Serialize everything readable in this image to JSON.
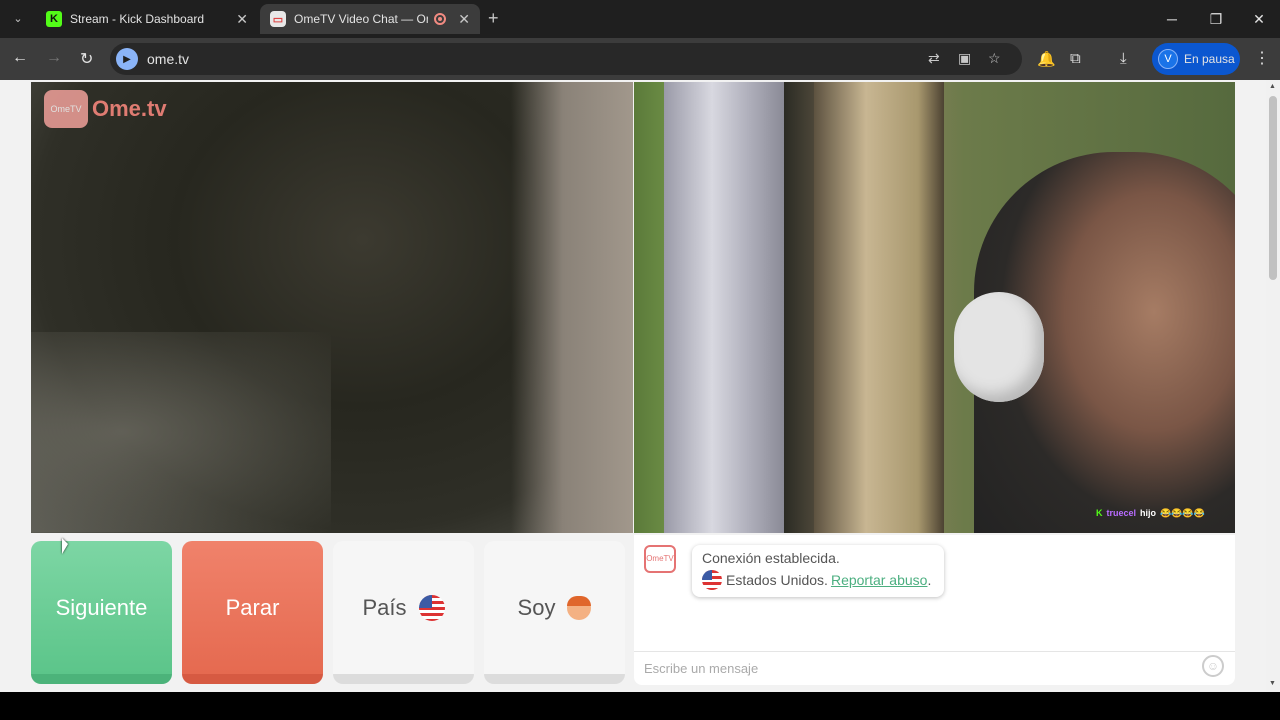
{
  "tabs": [
    {
      "title": "Stream - Kick Dashboard",
      "favicon": "kick-icon"
    },
    {
      "title": "OmeTV Video Chat — Ome",
      "favicon": "ometv-icon",
      "recording": true
    }
  ],
  "address_bar": {
    "url": "ome.tv"
  },
  "profile": {
    "initial": "V",
    "label": "En pausa"
  },
  "page": {
    "logo": {
      "badge_line1": "Ome",
      "badge_line2": "TV",
      "text": "Ome.tv"
    },
    "overlay_chat": {
      "user": "truecel",
      "message": "hijo",
      "emojis": "😂😂😂😂"
    },
    "buttons": {
      "next": "Siguiente",
      "stop": "Parar",
      "country": "País",
      "gender": "Soy"
    },
    "chat": {
      "status": "Conexión establecida.",
      "country": "Estados Unidos.",
      "report_link": "Reportar abuso",
      "report_suffix": ".",
      "input_placeholder": "Escribe un mensaje"
    }
  },
  "colors": {
    "next": "#5cc58a",
    "stop": "#e56a50",
    "accent": "#53fc18"
  }
}
